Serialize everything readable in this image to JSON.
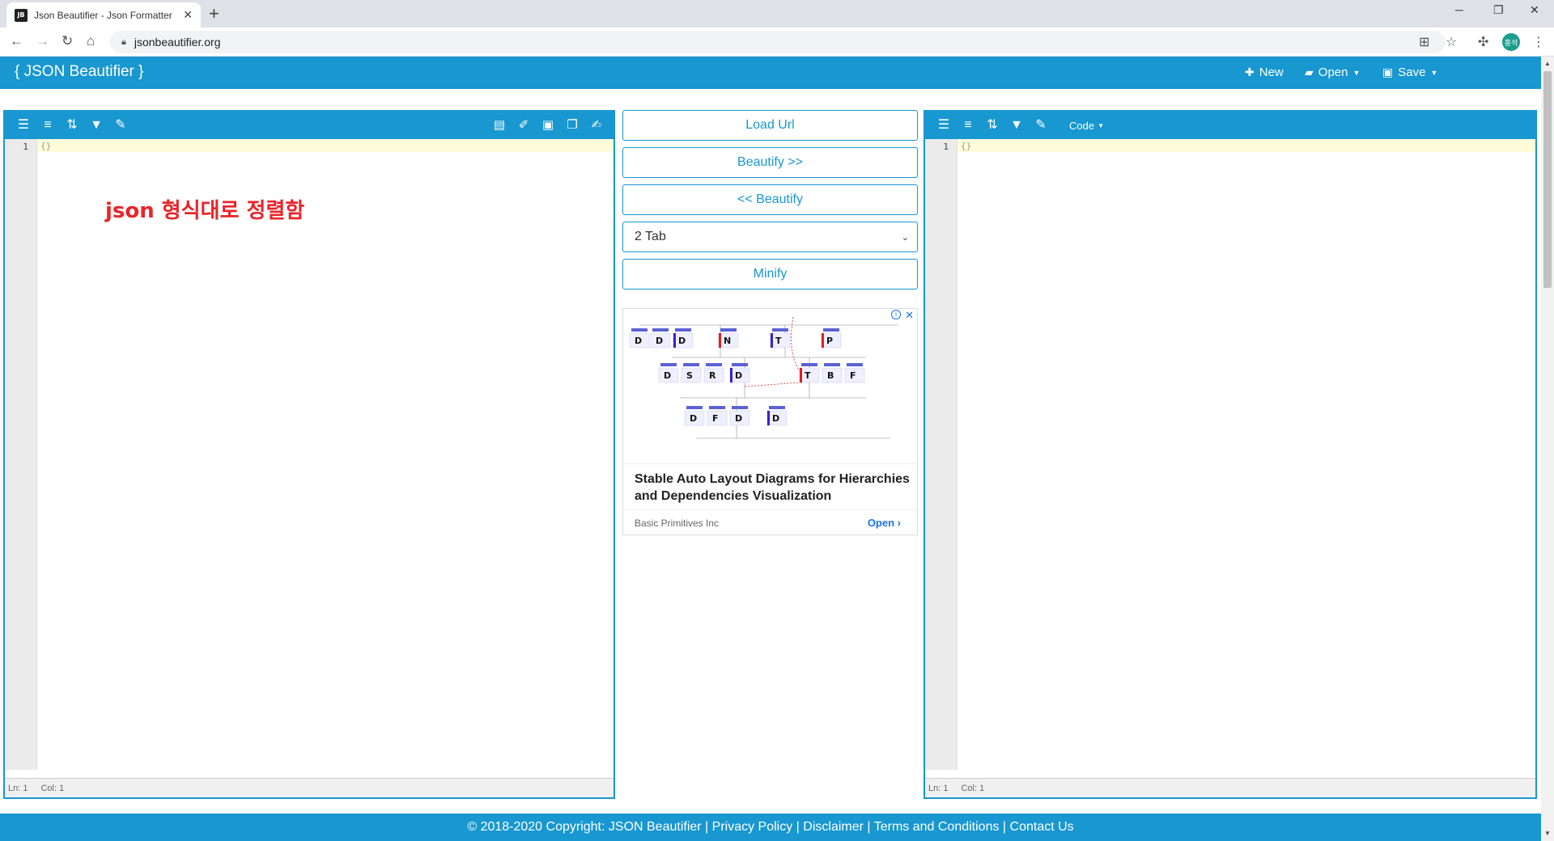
{
  "browser": {
    "tab_title": "Json Beautifier - Json Formatter",
    "favicon_text": "JB",
    "url": "jsonbeautifier.org",
    "profile_initials": "홍석"
  },
  "app": {
    "brand": "{ JSON Beautifier }",
    "menu": {
      "new": "New",
      "open": "Open",
      "save": "Save"
    }
  },
  "left_editor": {
    "line_number": "1",
    "content": "{}",
    "status_ln": "Ln: 1",
    "status_col": "Col: 1"
  },
  "right_editor": {
    "line_number": "1",
    "content": "{}",
    "mode_menu": "Code",
    "status_ln": "Ln: 1",
    "status_col": "Col: 1"
  },
  "annotation": "json 형식대로 정렬함",
  "controls": {
    "load_url": "Load Url",
    "beautify_right": "Beautify >>",
    "beautify_left": "<< Beautify",
    "indent_selected": "2 Tab",
    "minify": "Minify"
  },
  "ad": {
    "title": "Stable Auto Layout Diagrams for Hierarchies and Dependencies Visualization",
    "advertiser": "Basic Primitives Inc",
    "cta": "Open",
    "diagram_nodes": [
      "D",
      "D",
      "D",
      "N",
      "T",
      "P",
      "D",
      "S",
      "R",
      "D",
      "T",
      "B",
      "F",
      "D",
      "F",
      "D",
      "D"
    ]
  },
  "footer": {
    "copyright": "© 2018-2020 Copyright: JSON Beautifier",
    "links": [
      "Privacy Policy",
      "Disclaimer",
      "Terms and Conditions",
      "Contact Us"
    ]
  },
  "colors": {
    "primary": "#1897d0",
    "annotation": "#e8252a"
  }
}
